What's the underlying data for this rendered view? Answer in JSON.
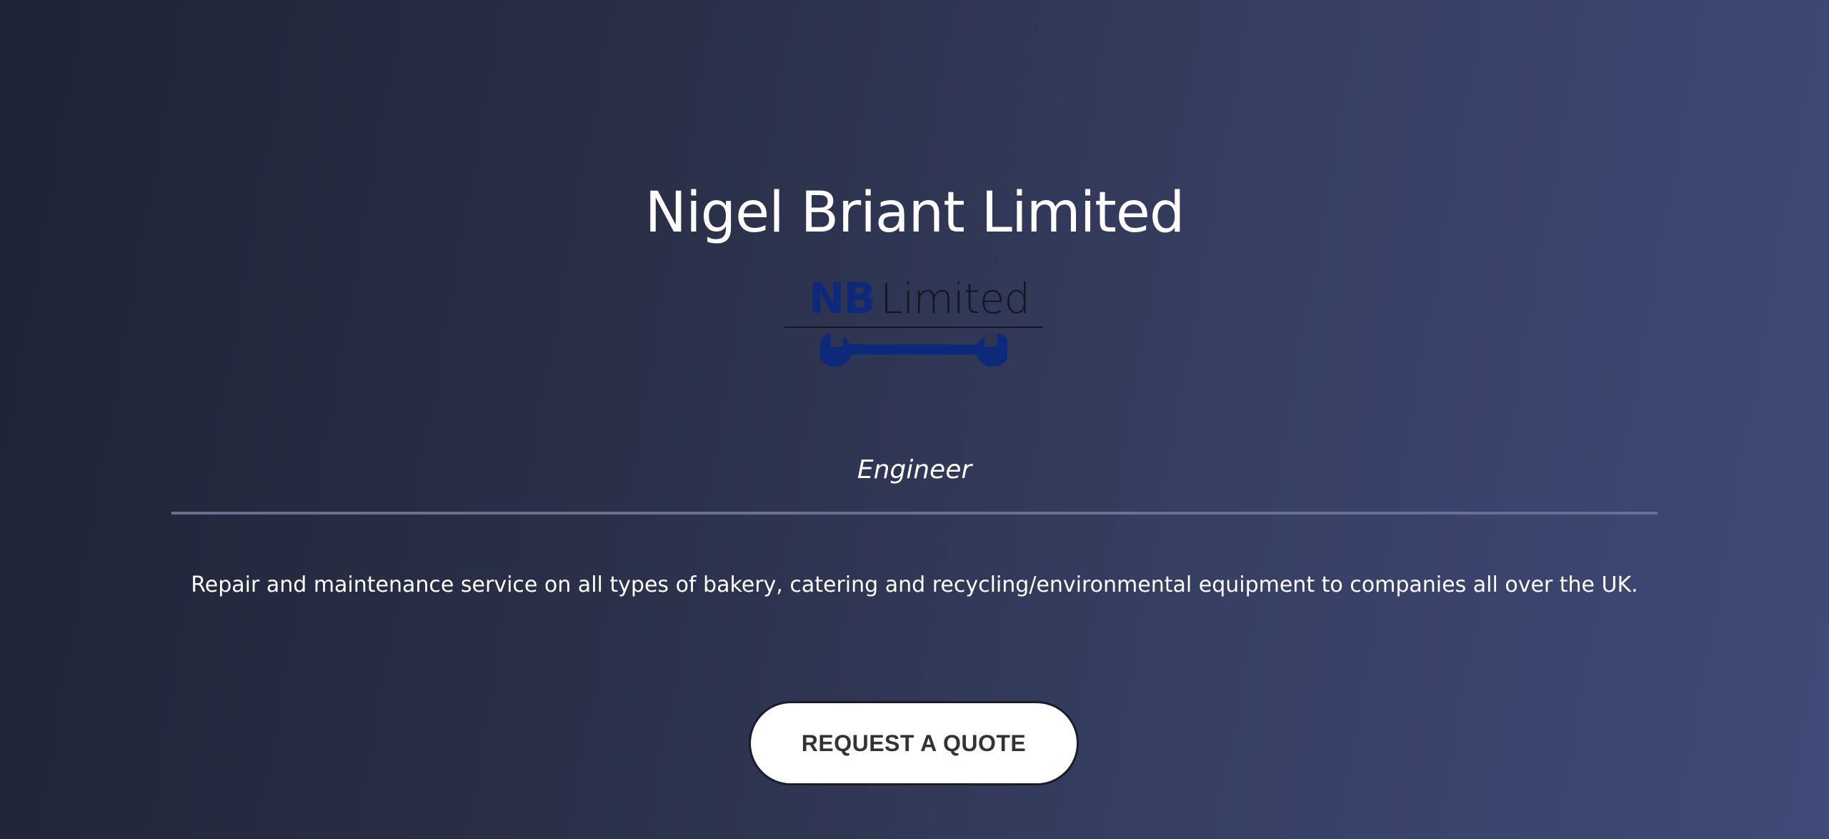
{
  "hero": {
    "title": "Nigel Briant Limited",
    "role": "Engineer",
    "description": "Repair and maintenance service on all types of bakery, catering and recycling/environmental equipment to companies all over the UK.",
    "cta_label": "REQUEST A QUOTE"
  },
  "logo": {
    "initials": "NB",
    "word": "Limited",
    "icon": "wrench-icon",
    "brand_color": "#0d2a7a"
  },
  "colors": {
    "background_start": "#1f2336",
    "background_end": "#3f4a78",
    "divider": "#6a7190",
    "button_background": "#ffffff",
    "button_text": "#333333"
  }
}
